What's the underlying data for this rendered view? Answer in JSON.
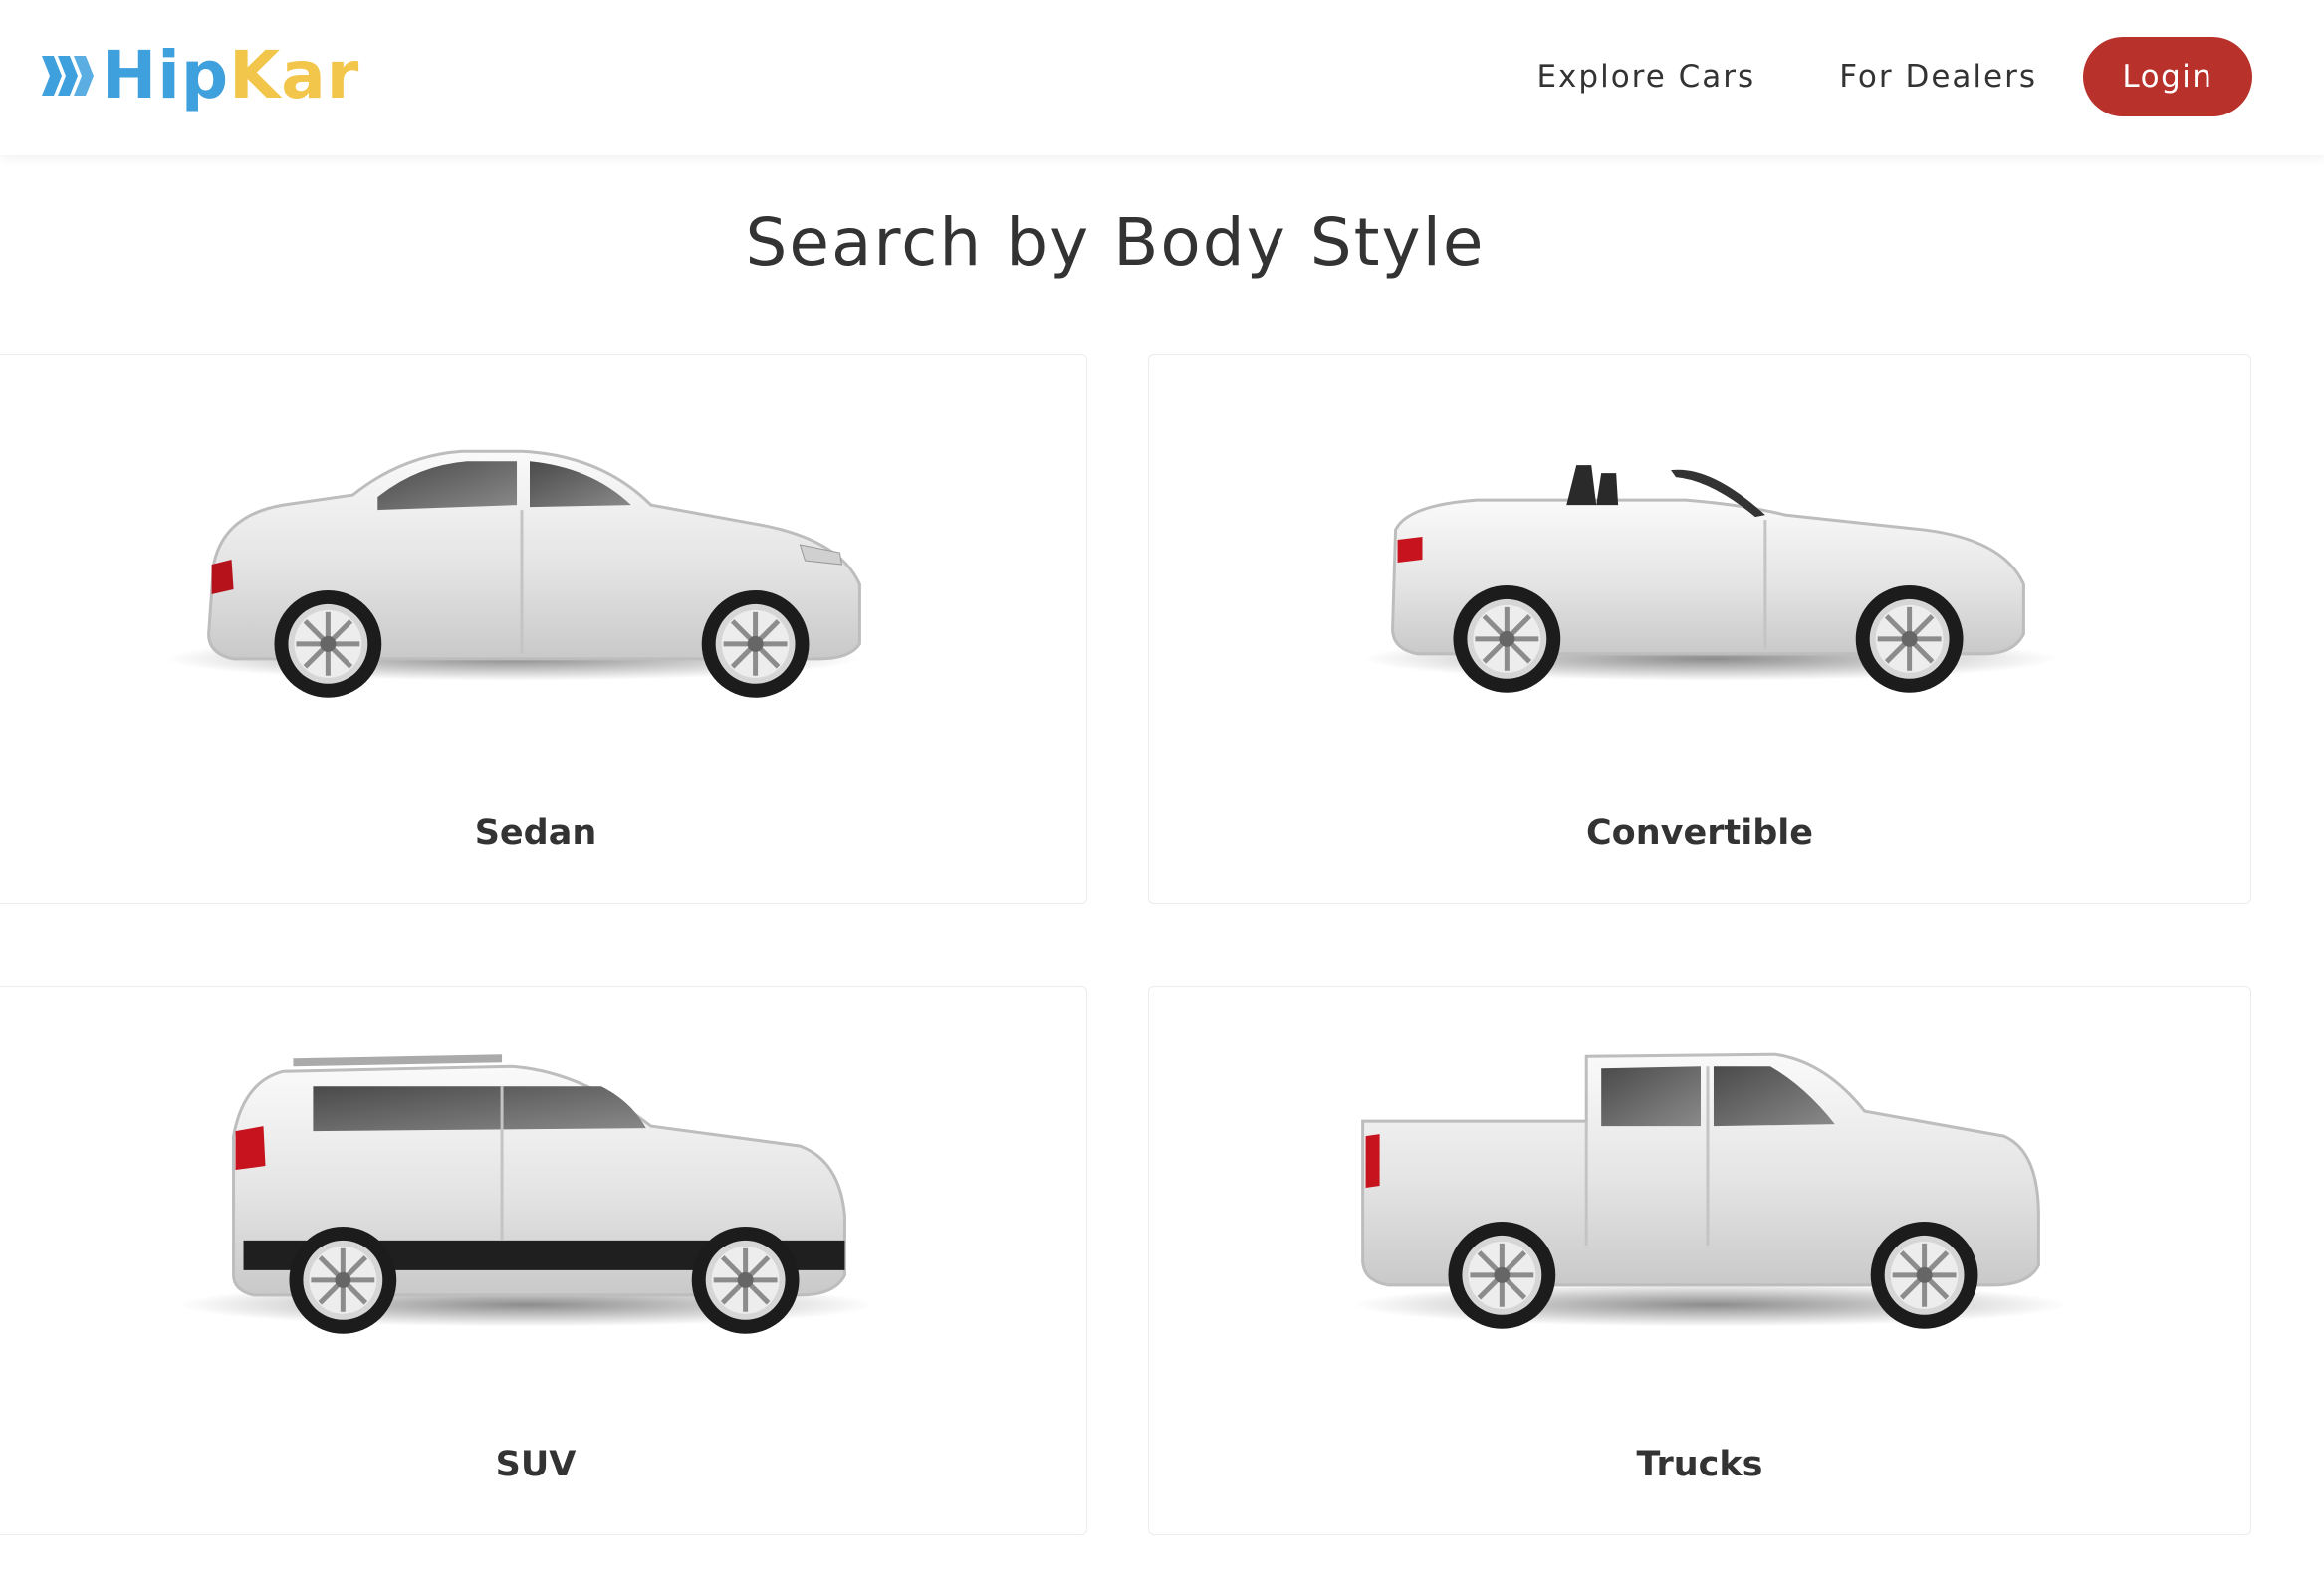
{
  "header": {
    "logo": {
      "part1": "Hip",
      "part2": "Kar",
      "icon": "hipkar-chevrons-logo-icon"
    },
    "nav": {
      "explore": "Explore Cars",
      "dealers": "For Dealers",
      "login": "Login"
    }
  },
  "page": {
    "title": "Search by Body Style"
  },
  "body_styles": [
    {
      "label": "Sedan",
      "image": "white-sedan-image"
    },
    {
      "label": "Convertible",
      "image": "white-convertible-image"
    },
    {
      "label": "SUV",
      "image": "white-suv-image"
    },
    {
      "label": "Trucks",
      "image": "white-pickup-truck-image"
    }
  ],
  "colors": {
    "logo_blue": "#3ea0dc",
    "logo_yellow": "#f2c64b",
    "login_red": "#b8312b",
    "text_dark": "#333333"
  }
}
